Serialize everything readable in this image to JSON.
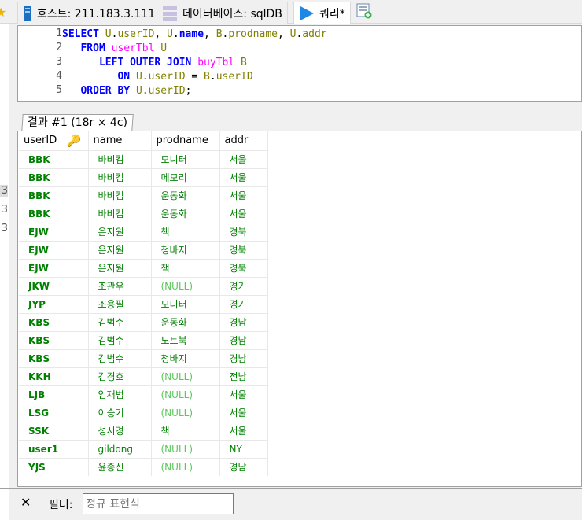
{
  "tabs": [
    {
      "label": "호스트: 211.183.3.111"
    },
    {
      "label": "데이터베이스: sqlDB"
    },
    {
      "label": "쿼리*"
    }
  ],
  "editor": {
    "line_numbers": [
      "1",
      "2",
      "3",
      "4",
      "5"
    ]
  },
  "left_panel": {
    "labels": [
      "3",
      "3",
      "3"
    ]
  },
  "results": {
    "tab_label": "결과 #1 (18r × 4c)",
    "columns": [
      "userID",
      "name",
      "prodname",
      "addr"
    ],
    "rows": [
      [
        "BBK",
        "바비킴",
        "모니터",
        "서울"
      ],
      [
        "BBK",
        "바비킴",
        "메모리",
        "서울"
      ],
      [
        "BBK",
        "바비킴",
        "운동화",
        "서울"
      ],
      [
        "BBK",
        "바비킴",
        "운동화",
        "서울"
      ],
      [
        "EJW",
        "은지원",
        "책",
        "경북"
      ],
      [
        "EJW",
        "은지원",
        "청바지",
        "경북"
      ],
      [
        "EJW",
        "은지원",
        "책",
        "경북"
      ],
      [
        "JKW",
        "조관우",
        "(NULL)",
        "경기"
      ],
      [
        "JYP",
        "조용필",
        "모니터",
        "경기"
      ],
      [
        "KBS",
        "김범수",
        "운동화",
        "경남"
      ],
      [
        "KBS",
        "김범수",
        "노트북",
        "경남"
      ],
      [
        "KBS",
        "김범수",
        "청바지",
        "경남"
      ],
      [
        "KKH",
        "김경호",
        "(NULL)",
        "전남"
      ],
      [
        "LJB",
        "임재범",
        "(NULL)",
        "서울"
      ],
      [
        "LSG",
        "이승기",
        "(NULL)",
        "서울"
      ],
      [
        "SSK",
        "성시경",
        "책",
        "서울"
      ],
      [
        "user1",
        "gildong",
        "(NULL)",
        "NY"
      ],
      [
        "YJS",
        "윤종신",
        "(NULL)",
        "경남"
      ]
    ]
  },
  "filter": {
    "label": "필터:",
    "placeholder": "정규 표현식",
    "close": "✕"
  }
}
